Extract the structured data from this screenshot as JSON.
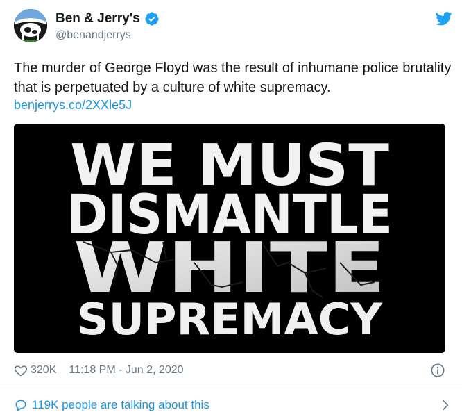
{
  "tweet": {
    "display_name": "Ben & Jerry's",
    "handle": "@benandjerrys",
    "text_lines": [
      "The murder of George Floyd was the result of inhumane police brutality",
      "that is perpetuated by a culture of white supremacy."
    ],
    "link": "benjerrys.co/2XXle5J",
    "media_lines": [
      "WE MUST",
      "DISMANTLE",
      "WHITE",
      "SUPREMACY"
    ],
    "likes": "320K",
    "timestamp": "11:18 PM - Jun 2, 2020",
    "talking": "119K people are talking about this"
  },
  "icons": {
    "verified": "verified-badge-icon",
    "brand": "twitter-bird-icon",
    "like": "heart-icon",
    "info": "info-icon",
    "reply": "comment-icon",
    "expand": "chevron-right-icon"
  },
  "colors": {
    "link": "#1b95e0",
    "muted": "#657786",
    "text": "#14171a"
  }
}
